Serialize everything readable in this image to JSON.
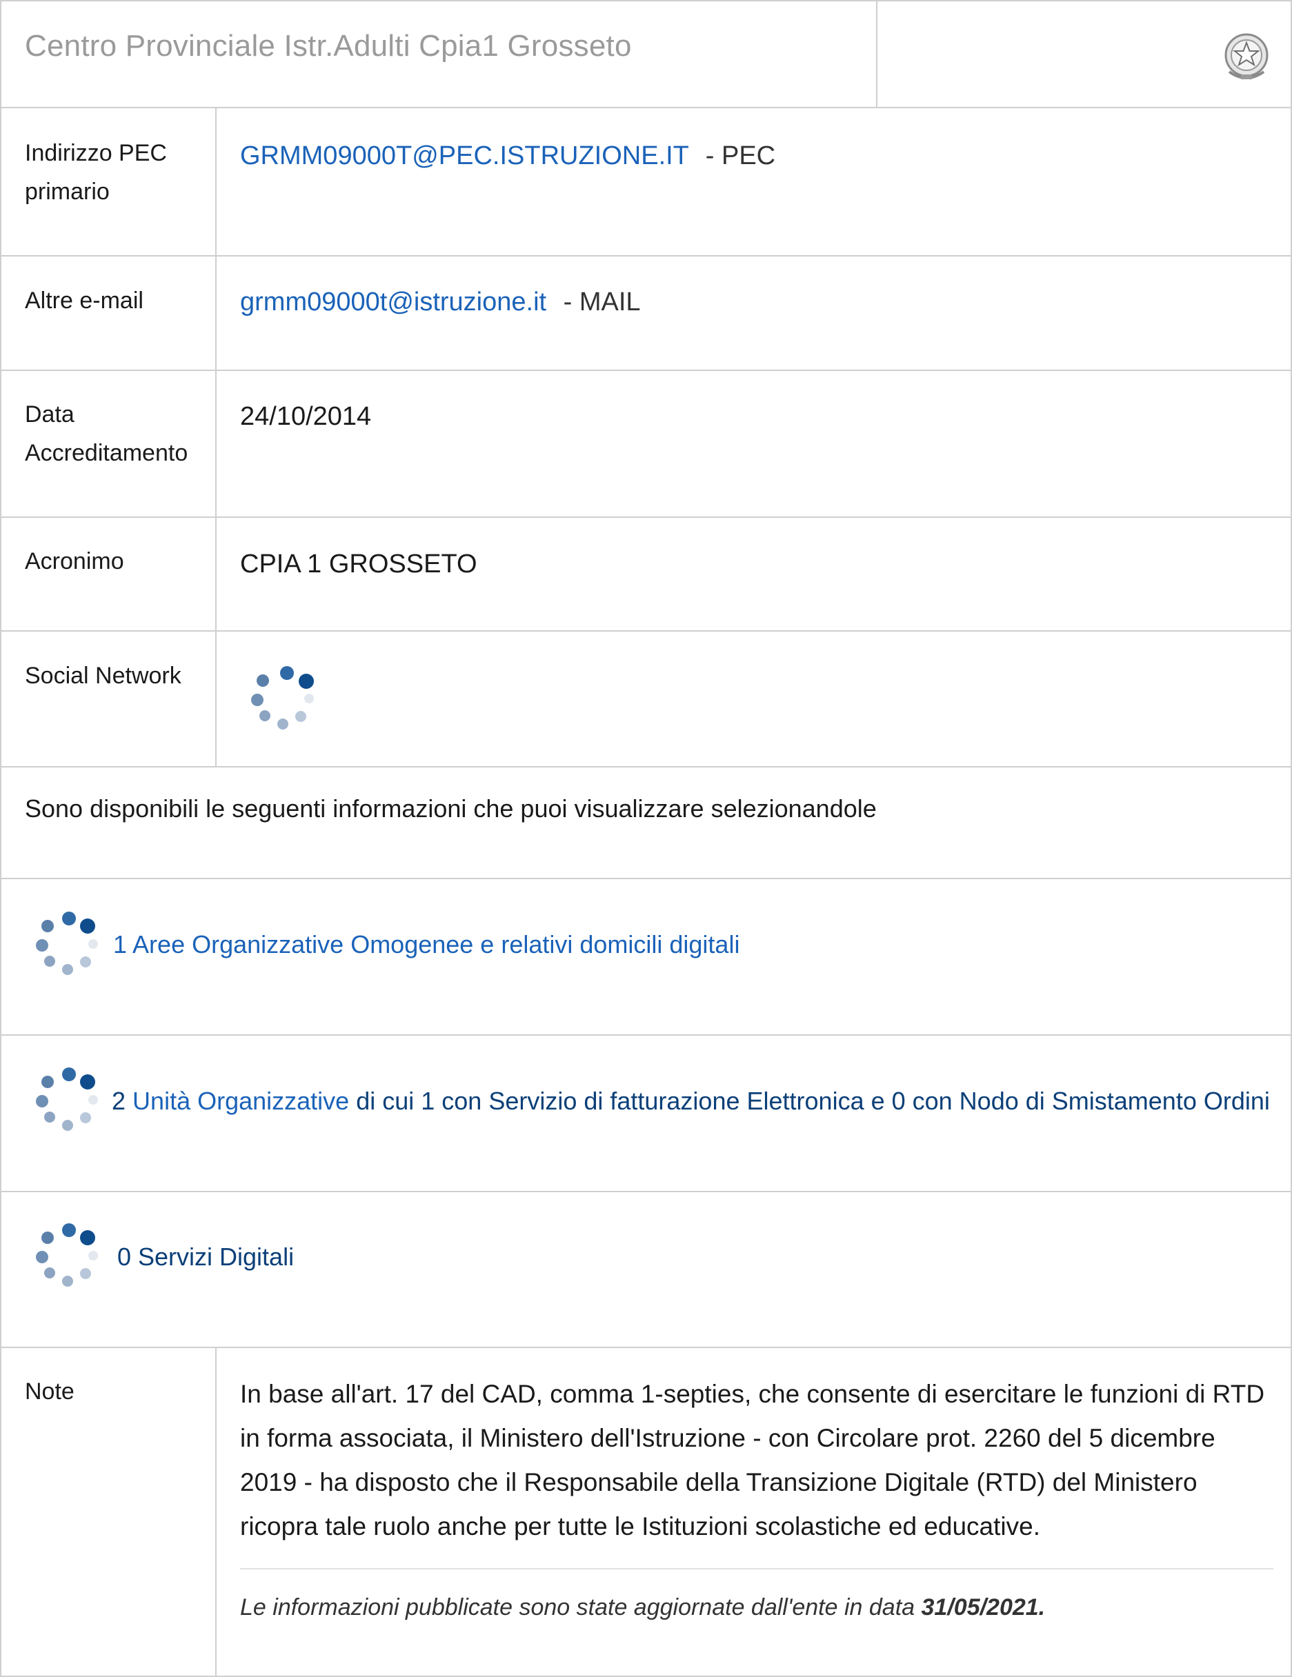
{
  "header": {
    "title": "Centro Provinciale Istr.Adulti Cpia1 Grosseto",
    "emblem_icon": "italian-republic-emblem-icon"
  },
  "fields": {
    "pec": {
      "label_line1": "Indirizzo PEC",
      "label_line2": "primario",
      "value": "GRMM09000T@PEC.ISTRUZIONE.IT",
      "suffix": "- PEC"
    },
    "email": {
      "label": "Altre e-mail",
      "value": "grmm09000t@istruzione.it",
      "suffix": "- MAIL"
    },
    "accreditation": {
      "label_line1": "Data",
      "label_line2": "Accreditamento",
      "value": "24/10/2014"
    },
    "acronym": {
      "label": "Acronimo",
      "value": "CPIA 1 GROSSETO"
    },
    "social": {
      "label": "Social Network",
      "icon": "loading-spinner-icon"
    }
  },
  "info_intro": "Sono disponibili le seguenti informazioni che puoi visualizzare selezionandole",
  "sections": {
    "aoo": {
      "count": "1",
      "link": "Aree Organizzative Omogenee e relativi domicili digitali"
    },
    "uo": {
      "count": "2",
      "link": "Unità Organizzative",
      "rest": "di cui 1 con Servizio di fatturazione Elettronica e 0 con Nodo di Smistamento Ordini"
    },
    "services": {
      "text": "0 Servizi Digitali"
    }
  },
  "note": {
    "label": "Note",
    "text": "In base all'art. 17 del CAD, comma 1-septies, che consente di esercitare le funzioni di RTD in forma associata, il Ministero dell'Istruzione - con Circolare prot. 2260 del 5 dicembre 2019 - ha disposto che il Responsabile della Transizione Digitale (RTD) del Ministero ricopra tale ruolo anche per tutte le Istituzioni scolastiche ed educative.",
    "updated_prefix": "Le informazioni pubblicate sono state aggiornate dall'ente in data",
    "updated_date": "31/05/2021."
  },
  "colors": {
    "link": "#1a62b8",
    "navy": "#0b3f78",
    "border": "#cfcfcf",
    "header_text": "#9a9a9a"
  }
}
